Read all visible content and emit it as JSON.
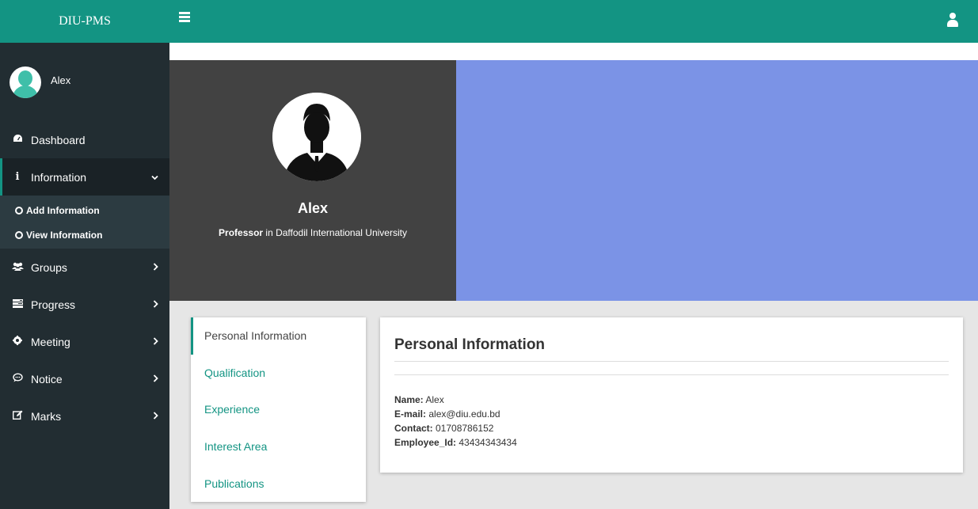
{
  "app": {
    "brand": "DIU-PMS",
    "user_name": "Alex"
  },
  "sidebar": {
    "items": [
      {
        "label": "Dashboard",
        "icon": "dashboard-icon"
      },
      {
        "label": "Information",
        "icon": "info-icon",
        "expanded": true,
        "subitems": [
          "Add Information",
          "View Information"
        ]
      },
      {
        "label": "Groups",
        "icon": "users-icon"
      },
      {
        "label": "Progress",
        "icon": "tasks-icon"
      },
      {
        "label": "Meeting",
        "icon": "meeting-icon"
      },
      {
        "label": "Notice",
        "icon": "comment-icon"
      },
      {
        "label": "Marks",
        "icon": "edit-icon"
      }
    ]
  },
  "profile": {
    "name": "Alex",
    "role": "Professor",
    "role_suffix": " in Daffodil International University"
  },
  "tabs": [
    "Personal Information",
    "Qualification",
    "Experience",
    "Interest Area",
    "Publications"
  ],
  "personal_info": {
    "title": "Personal Information",
    "fields": [
      {
        "label": "Name:",
        "value": " Alex"
      },
      {
        "label": "E-mail:",
        "value": " alex@diu.edu.bd"
      },
      {
        "label": "Contact:",
        "value": " 01708786152"
      },
      {
        "label": "Employee_Id:",
        "value": " 43434343434"
      }
    ]
  },
  "colors": {
    "accent": "#139483",
    "sidebar": "#222d32",
    "cover": "#7b93e6",
    "profile_bg": "#424242"
  }
}
